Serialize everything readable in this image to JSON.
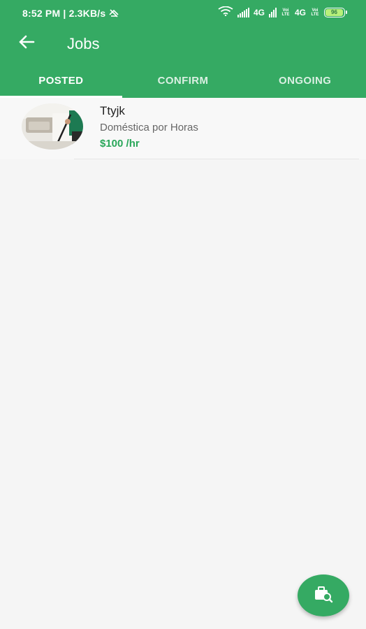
{
  "status_bar": {
    "time_speed": "8:52 PM | 2.3KB/s",
    "network_1": "4G",
    "network_2": "4G",
    "volte_label": "Voi LTE",
    "battery": "96"
  },
  "toolbar": {
    "title": "Jobs",
    "back_icon": "arrow-left-icon"
  },
  "tabs": [
    {
      "label": "POSTED",
      "active": true
    },
    {
      "label": "CONFIRM",
      "active": false
    },
    {
      "label": "ONGOING",
      "active": false
    }
  ],
  "jobs": [
    {
      "title": "Ttyjk",
      "category": "Doméstica por Horas",
      "rate": "$100 /hr"
    }
  ],
  "fab": {
    "icon": "briefcase-search-icon"
  },
  "colors": {
    "primary": "#35aa63",
    "rate_text": "#2aa75a",
    "background": "#f5f5f5"
  }
}
